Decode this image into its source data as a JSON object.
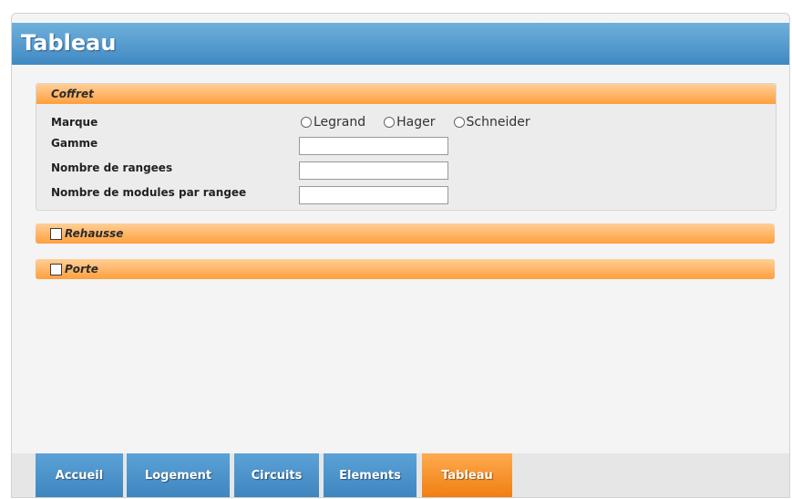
{
  "header": {
    "title": "Tableau"
  },
  "coffret": {
    "title": "Coffret",
    "marque_label": "Marque",
    "marque_options": [
      "Legrand",
      "Hager",
      "Schneider"
    ],
    "gamme_label": "Gamme",
    "rangees_label": "Nombre de rangees",
    "modules_label": "Nombre de modules par rangee"
  },
  "rehausse": {
    "title": "Rehausse"
  },
  "porte": {
    "title": "Porte"
  },
  "tabs": [
    {
      "label": "Accueil",
      "active": false
    },
    {
      "label": "Logement",
      "active": false
    },
    {
      "label": "Circuits",
      "active": false
    },
    {
      "label": "Elements",
      "active": false
    },
    {
      "label": "Tableau",
      "active": true
    }
  ],
  "colors": {
    "header_blue": "#4a93c9",
    "panel_orange": "#ffb363",
    "active_tab_orange": "#f48a1d"
  }
}
